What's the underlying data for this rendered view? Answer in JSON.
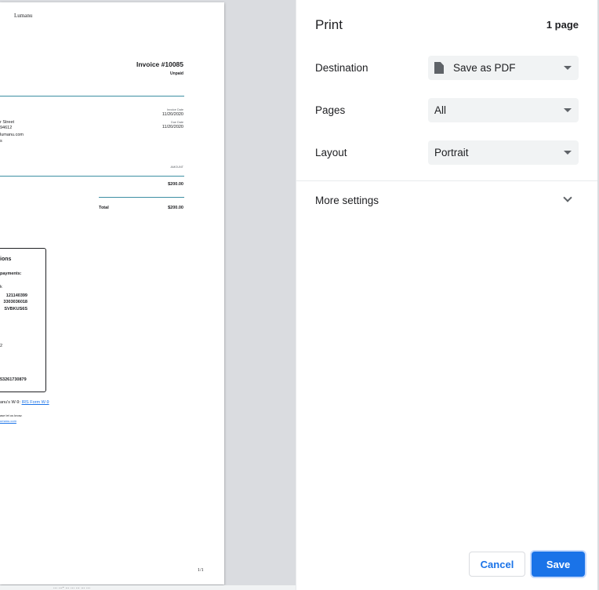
{
  "preview": {
    "brand": "Lumanu",
    "invoice_title": "Invoice #10085",
    "status": "Unpaid",
    "invoice_date_label": "Invoice Date",
    "invoice_date": "11/20/2020",
    "due_date_label": "Due Date",
    "due_date": "11/20/2020",
    "address_line1": "r Street",
    "address_line2": " 94612",
    "email": "lumanu.com",
    "address_line4": "s",
    "amount_header": "AMOUNT",
    "line_amount": "$200.00",
    "total_label": "Total",
    "total_amount": "$200.00",
    "instructions_heading": "ions",
    "payments_label": "payments:",
    "bank_k": "k",
    "routing_number": "121140399",
    "account_number": "3303036018",
    "swift_code": "SVBKUS6S",
    "number_2": "2",
    "long_number": "53261730879",
    "w9_text": "anu's W-9:",
    "w9_link": "IRS Form W-9",
    "contact_text": "ase let us know.",
    "contact_link": "umanu.com",
    "page_indicator": "1/1",
    "footer_fragment": "...  ...-  ...  ...  ... ...    ..."
  },
  "print_panel": {
    "title": "Print",
    "page_count": "1 page",
    "destination": {
      "label": "Destination",
      "value": "Save as PDF",
      "icon": "pdf-file-icon"
    },
    "pages": {
      "label": "Pages",
      "value": "All"
    },
    "layout": {
      "label": "Layout",
      "value": "Portrait"
    },
    "more_settings": "More settings",
    "cancel_label": "Cancel",
    "save_label": "Save"
  },
  "colors": {
    "accent": "#1a73e8",
    "select_bg": "#f1f3f4",
    "preview_bg": "#dadce0",
    "invoice_rule": "#3d8fa3",
    "link": "#1a73e8"
  }
}
